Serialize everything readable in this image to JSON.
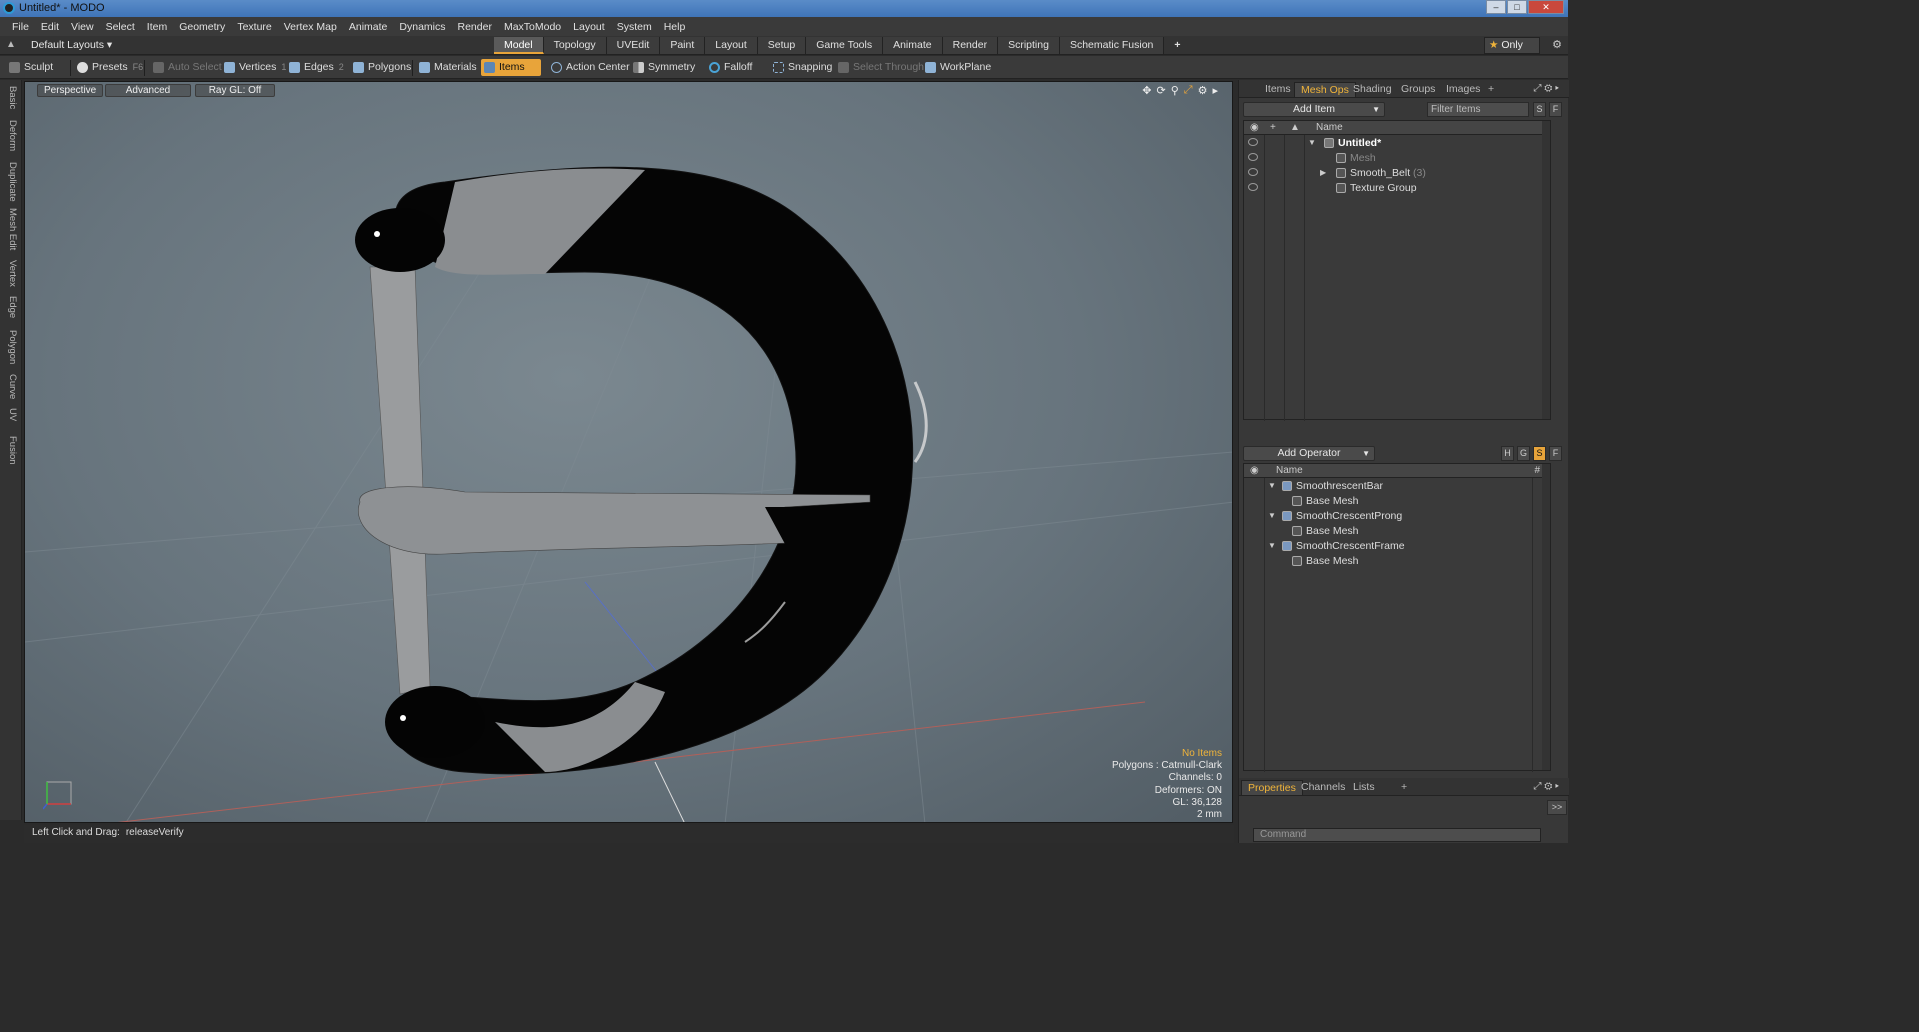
{
  "window": {
    "title": "Untitled* - MODO"
  },
  "menu": [
    "File",
    "Edit",
    "View",
    "Select",
    "Item",
    "Geometry",
    "Texture",
    "Vertex Map",
    "Animate",
    "Dynamics",
    "Render",
    "MaxToModo",
    "Layout",
    "System",
    "Help"
  ],
  "layout": {
    "default_layouts": "Default Layouts ▾",
    "tabs": [
      "Model",
      "Topology",
      "UVEdit",
      "Paint",
      "Layout",
      "Setup",
      "Game Tools",
      "Animate",
      "Render",
      "Scripting",
      "Schematic Fusion"
    ],
    "active_tab": "Model",
    "plus": "+",
    "only_label": "Only",
    "star": "★"
  },
  "toolbar": {
    "sculpt": "Sculpt",
    "presets": "Presets",
    "presets_key": "F6",
    "auto_select": "Auto Select",
    "vertices": "Vertices",
    "vertices_count": "1",
    "edges": "Edges",
    "edges_count": "2",
    "polygons": "Polygons",
    "materials": "Materials",
    "items": "Items",
    "action_center": "Action Center",
    "symmetry": "Symmetry",
    "falloff": "Falloff",
    "snapping": "Snapping",
    "select_through": "Select Through",
    "workplane": "WorkPlane"
  },
  "left_tabs": [
    "Basic",
    "Deform",
    "Duplicate",
    "Mesh Edit",
    "Vertex",
    "Edge",
    "Polygon",
    "Curve",
    "UV",
    "Fusion"
  ],
  "viewport": {
    "perspective": "Perspective",
    "advanced": "Advanced",
    "raygl": "Ray GL: Off",
    "info": {
      "no_items": "No Items",
      "polygons": "Polygons : Catmull-Clark",
      "channels": "Channels: 0",
      "deformers": "Deformers: ON",
      "gl": "GL: 36,128",
      "scale": "2 mm"
    }
  },
  "status": {
    "label": "Left Click and Drag:",
    "value": "releaseVerify"
  },
  "right_panel": {
    "tabs": [
      "Items",
      "Mesh Ops",
      "Shading",
      "Groups",
      "Images"
    ],
    "active_tab": "Mesh Ops",
    "add_item": "Add Item",
    "filter_placeholder": "Filter Items",
    "s_btn": "S",
    "f_btn": "F",
    "items_header": "Name",
    "items": [
      {
        "label": "Untitled*",
        "count": ""
      },
      {
        "label": "Mesh",
        "count": ""
      },
      {
        "label": "Smooth_Belt",
        "count": "(3)"
      },
      {
        "label": "Texture Group",
        "count": ""
      }
    ],
    "add_operator": "Add Operator",
    "op_buttons": [
      "H",
      "G",
      "S",
      "F"
    ],
    "ops_header": "Name",
    "ops_hash": "#",
    "operators": [
      {
        "label": "SmoothrescentBar",
        "child": "Base Mesh"
      },
      {
        "label": "SmoothCrescentProng",
        "child": "Base Mesh"
      },
      {
        "label": "SmoothCrescentFrame",
        "child": "Base Mesh"
      }
    ],
    "bottom_tabs": [
      "Properties",
      "Channels",
      "Lists"
    ],
    "bottom_active": "Properties",
    "expand": ">>",
    "command_placeholder": "Command"
  }
}
